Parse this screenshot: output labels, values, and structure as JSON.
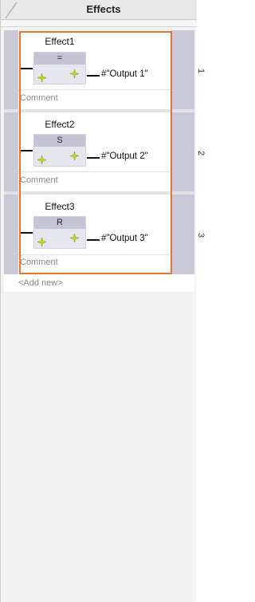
{
  "header": {
    "title": "Effects"
  },
  "effects": [
    {
      "title": "Effect1",
      "block_label": "=",
      "output": "#\"Output 1\"",
      "comment": "Comment",
      "index": "1"
    },
    {
      "title": "Effect2",
      "block_label": "S",
      "output": "#\"Output 2\"",
      "comment": "Comment",
      "index": "2"
    },
    {
      "title": "Effect3",
      "block_label": "R",
      "output": "#\"Output 3\"",
      "comment": "Comment",
      "index": "3"
    }
  ],
  "add_new": "<Add new>",
  "colors": {
    "highlight": "#e8772a",
    "gutter": "#c9c9d7",
    "block_head": "#c4c4d4",
    "star": "#c8e000"
  }
}
